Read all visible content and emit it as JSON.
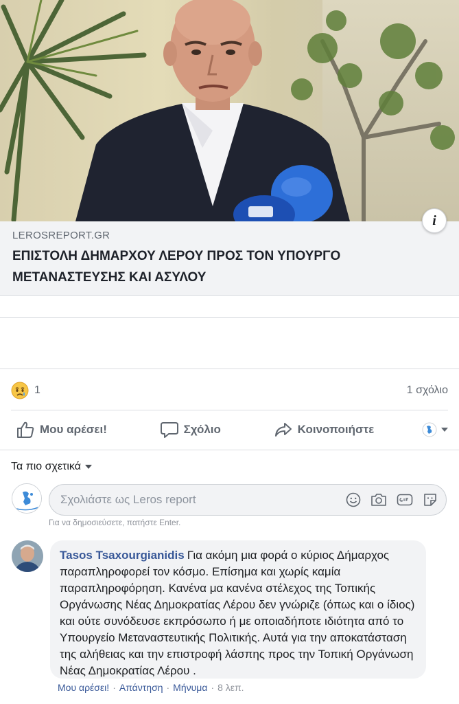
{
  "link_preview": {
    "domain": "LEROSREPORT.GR",
    "title": "ΕΠΙΣΤΟΛΗ ΔΗΜΑΡΧΟΥ ΛΕΡΟΥ ΠΡΟΣ ΤΟΝ ΥΠΟΥΡΓΟ ΜΕΤΑΝΑΣΤΕΥΣΗΣ ΚΑΙ ΑΣΥΛΟΥ",
    "info_icon": "i"
  },
  "reactions": {
    "emoji": "sad-reaction-icon",
    "count": "1",
    "comments_count": "1 σχόλιο"
  },
  "actions": {
    "like": "Μου αρέσει!",
    "comment": "Σχόλιο",
    "share": "Κοινοποιήστε"
  },
  "comments": {
    "sort_label": "Τα πιο σχετικά",
    "composer_placeholder": "Σχολιάστε ως Leros report",
    "composer_hint": "Για να δημοσιεύσετε, πατήστε Enter.",
    "items": [
      {
        "author": "Tasos Tsaxourgianidis",
        "text": "Για ακόμη μια φορά ο κύριος Δήμαρχος παραπληροφορεί τον κόσμο. Επίσημα και χωρίς καμία παραπληροφόρηση. Κανένα μα κανένα στέλεχος της Τοπικής Οργάνωσης Νέας Δημοκρατίας Λέρου δεν γνώριζε (όπως και ο ίδιος) και ούτε συνόδευσε εκπρόσωπο ή με οποιαδήποτε ιδιότητα από το Υπουργείο Μεταναστευτικής Πολιτικής. Αυτά για την αποκατάσταση της αλήθειας και την επιστροφή λάσπης προς την Τοπική Οργάνωση Νέας Δημοκρατίας Λέρου .",
        "like_label": "Μου αρέσει!",
        "reply_label": "Απάντηση",
        "message_label": "Μήνυμα",
        "time": "8 λεπ.",
        "separator": "·"
      }
    ]
  },
  "colors": {
    "link_blue": "#385898",
    "muted_gray": "#606770",
    "bubble_bg": "#f2f3f5",
    "divider": "#dadde1"
  }
}
